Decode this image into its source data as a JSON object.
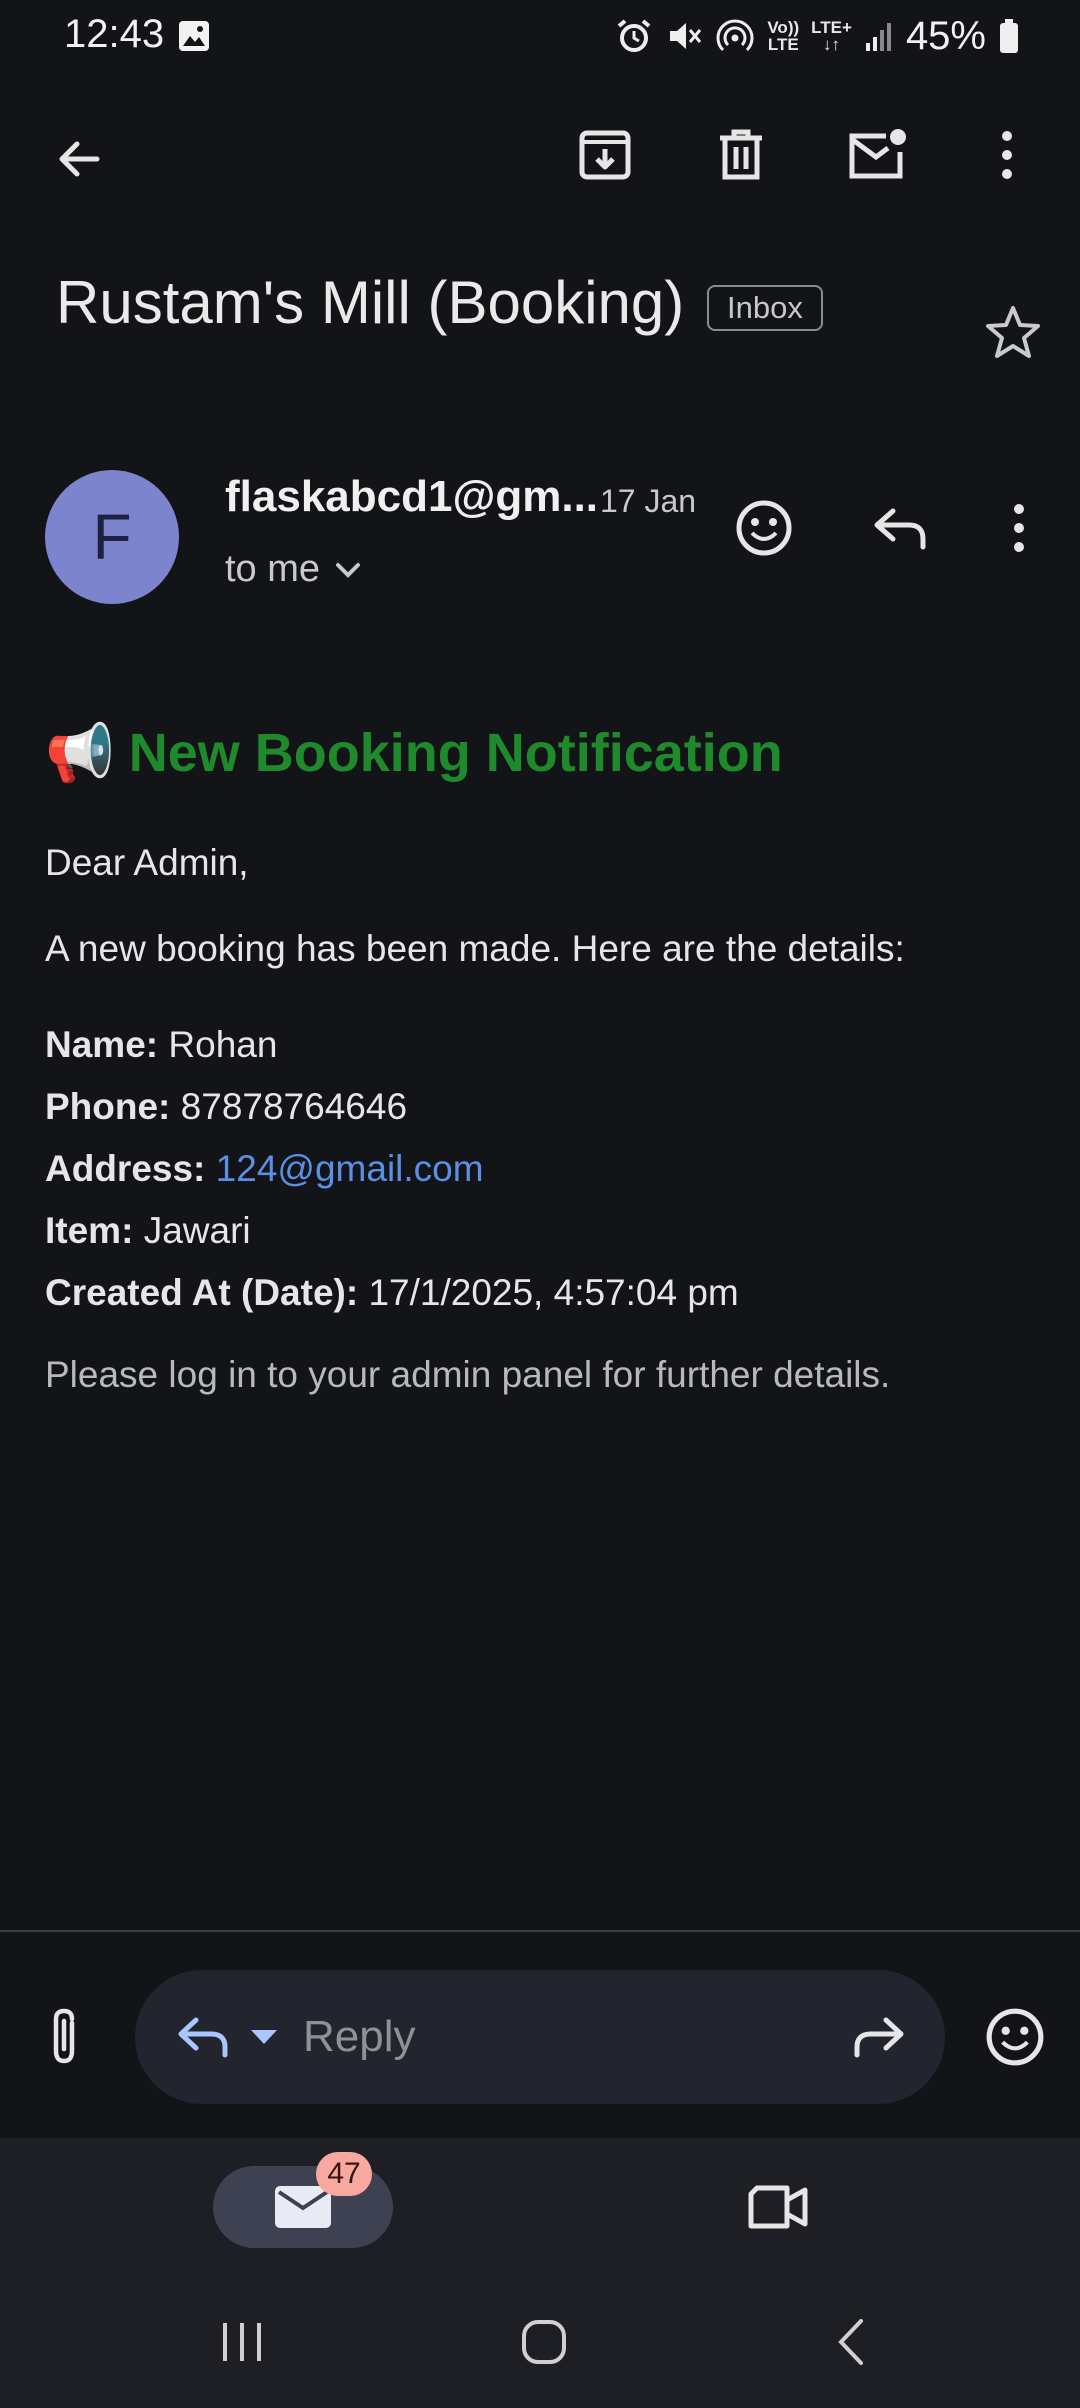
{
  "status_bar": {
    "time": "12:43",
    "lte_top": "Vo))",
    "lte_bottom": "LTE",
    "lte_plus": "LTE+",
    "battery": "45%"
  },
  "toolbar": {
    "back": "back-arrow-icon",
    "archive": "archive-icon",
    "delete": "trash-icon",
    "mark_unread": "mark-unread-icon",
    "more": "more-vert-icon"
  },
  "email": {
    "subject": "Rustam's Mill (Booking)",
    "label": "Inbox",
    "sender": {
      "avatar_letter": "F",
      "name": "flaskabcd1@gm...",
      "date": "17 Jan",
      "recipient": "to me"
    },
    "body": {
      "heading_emoji": "📢",
      "heading": "New Booking Notification",
      "greeting": "Dear Admin,",
      "intro": "A new booking has been made. Here are the details:",
      "details": [
        {
          "label": "Name:",
          "value": "Rohan"
        },
        {
          "label": "Phone:",
          "value": "87878764646"
        },
        {
          "label": "Address:",
          "value": "124@gmail.com"
        },
        {
          "label": "Item:",
          "value": "Jawari"
        },
        {
          "label": "Created At (Date):",
          "value": "17/1/2025, 4:57:04 pm"
        }
      ],
      "footer": "Please log in to your admin panel for further details."
    }
  },
  "reply_bar": {
    "placeholder": "Reply"
  },
  "bottom_nav": {
    "mail_badge": "47"
  },
  "colors": {
    "background": "#131418",
    "heading_green": "#1e8a2c",
    "link_blue": "#5b8fe6",
    "avatar": "#7b84cc",
    "badge": "#f7a9a0"
  }
}
